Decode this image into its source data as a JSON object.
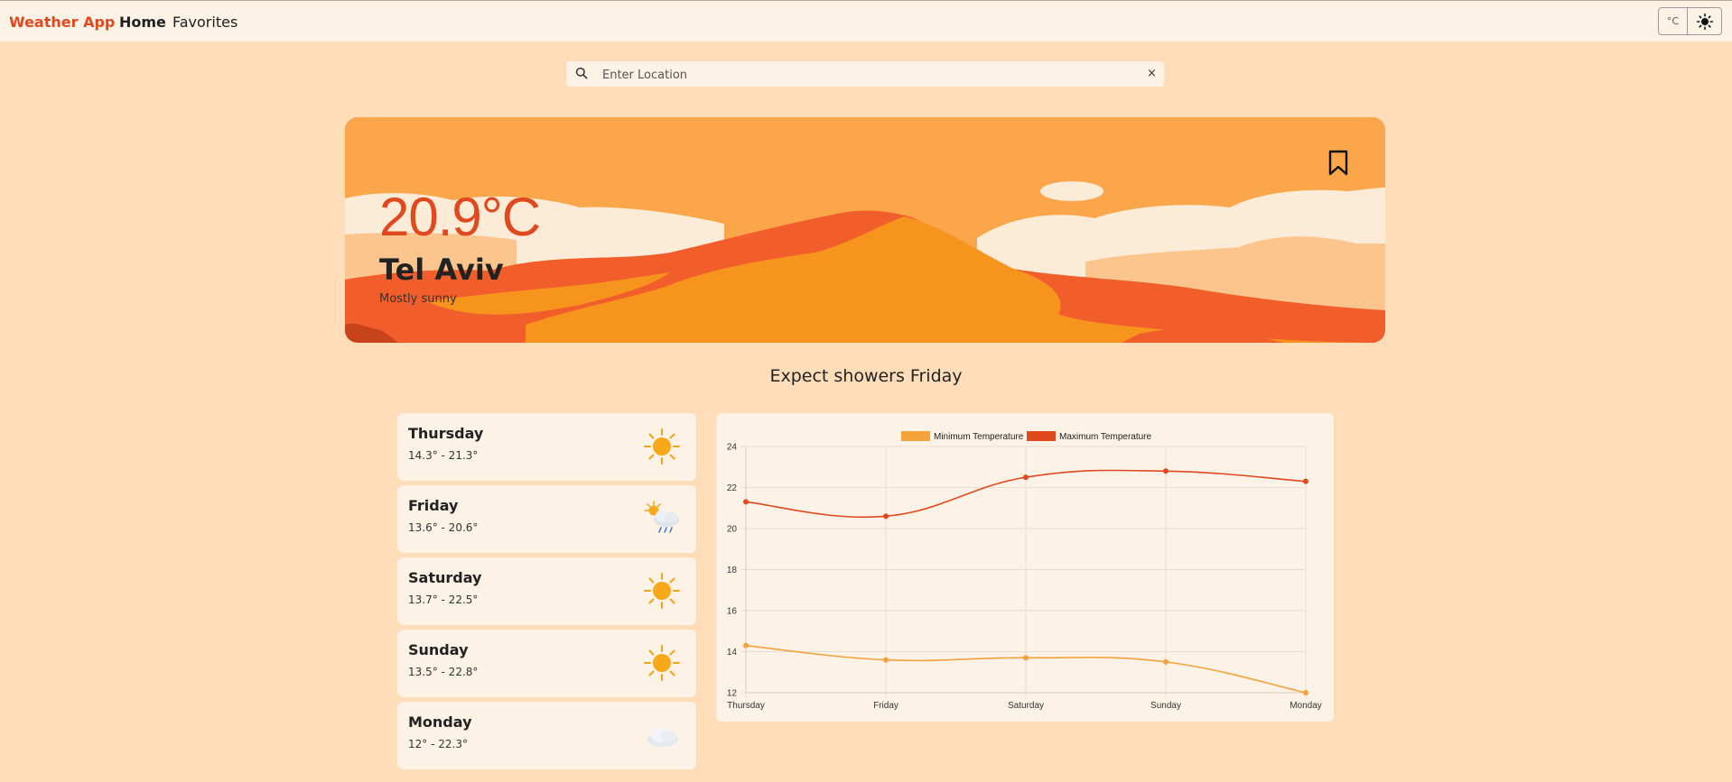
{
  "nav": {
    "brand": "Weather App",
    "home": "Home",
    "favorites": "Favorites",
    "unit_toggle": "°C",
    "theme_icon": "sun-icon"
  },
  "search": {
    "placeholder": "Enter Location",
    "value": "",
    "clear": "×"
  },
  "current": {
    "temperature": "20.9°C",
    "city": "Tel Aviv",
    "description": "Mostly sunny",
    "bookmark_icon": "bookmark-icon"
  },
  "headline": "Expect showers Friday",
  "forecast": [
    {
      "day": "Thursday",
      "range": "14.3° - 21.3°",
      "icon": "sunny-icon"
    },
    {
      "day": "Friday",
      "range": "13.6° - 20.6°",
      "icon": "sun-cloud-rain-icon"
    },
    {
      "day": "Saturday",
      "range": "13.7° - 22.5°",
      "icon": "sunny-icon"
    },
    {
      "day": "Sunday",
      "range": "13.5° - 22.8°",
      "icon": "sunny-icon"
    },
    {
      "day": "Monday",
      "range": "12° - 22.3°",
      "icon": "cloud-icon"
    }
  ],
  "colors": {
    "accent": "#E0481E",
    "background": "#FFDDB8",
    "card": "#FCF2E6",
    "min_series": "#F4A23C",
    "max_series": "#E0481E"
  },
  "chart_data": {
    "type": "line",
    "categories": [
      "Thursday",
      "Friday",
      "Saturday",
      "Sunday",
      "Monday"
    ],
    "series": [
      {
        "name": "Minimum Temperature",
        "values": [
          14.3,
          13.6,
          13.7,
          13.5,
          12
        ],
        "color": "#F4A23C"
      },
      {
        "name": "Maximum Temperature",
        "values": [
          21.3,
          20.6,
          22.5,
          22.8,
          22.3
        ],
        "color": "#E0481E"
      }
    ],
    "ylim": [
      12,
      24
    ],
    "yticks": [
      12,
      14,
      16,
      18,
      20,
      22,
      24
    ],
    "grid": true,
    "legend": "top-center"
  }
}
